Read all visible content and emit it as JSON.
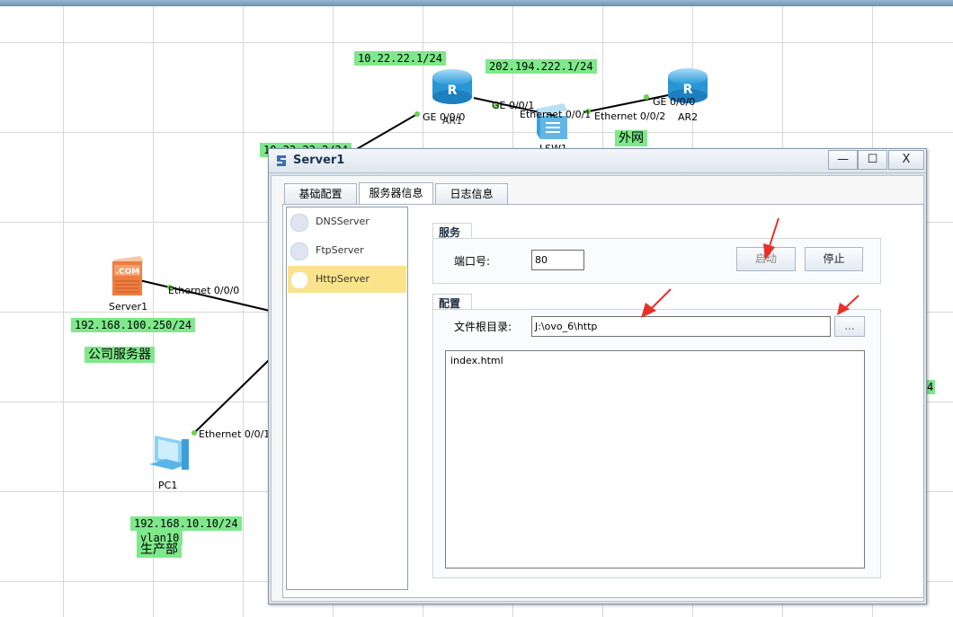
{
  "topology": {
    "ip_labels": {
      "ar1_top": "10.22.22.1/24",
      "lsw_top": "202.194.222.1/24",
      "partial_left": "10.22.22.2/24",
      "server1": "192.168.100.250/24",
      "pc1": "192.168.10.10/24",
      "pc1_vlan": "vlan10",
      "right_edge": "4"
    },
    "note_labels": {
      "server_note": "公司服务器",
      "pc_note": "生产部",
      "external": "外网"
    },
    "port_labels": {
      "ar1_ge000": "GE 0/0/0",
      "ar1_ge001": "GE 0/0/1",
      "lsw_eth001": "Ethernet 0/0/1",
      "lsw_eth002": "Ethernet 0/0/2",
      "ar2_ge000": "GE 0/0/0",
      "server_eth000": "Ethernet 0/0/0",
      "pc_eth001": "Ethernet 0/0/1"
    },
    "device_names": {
      "ar1": "AR1",
      "ar2": "AR2",
      "lsw": "LSW1",
      "server1": "Server1",
      "pc1": "PC1"
    },
    "server_badge": ".COM",
    "router_letter": "R"
  },
  "window": {
    "title": "Server1",
    "controls": {
      "minimize": "—",
      "maximize": "☐",
      "close": "X"
    },
    "tabs": [
      {
        "label": "基础配置",
        "active": false
      },
      {
        "label": "服务器信息",
        "active": true
      },
      {
        "label": "日志信息",
        "active": false
      }
    ],
    "services": [
      {
        "label": "DNSServer",
        "selected": false
      },
      {
        "label": "FtpServer",
        "selected": false
      },
      {
        "label": "HttpServer",
        "selected": true
      }
    ],
    "service_group": {
      "title": "服务",
      "port_label": "端口号:",
      "port_value": "80",
      "start_label": "启动",
      "stop_label": "停止"
    },
    "config_group": {
      "title": "配置",
      "root_label": "文件根目录:",
      "root_value": "J:\\ovo_6\\http",
      "browse_label": "...",
      "files": [
        "index.html"
      ]
    }
  },
  "colors": {
    "label_green": "#7ee88a",
    "selected_item": "#fbe38c",
    "annotation_arrow": "#e8302a"
  }
}
